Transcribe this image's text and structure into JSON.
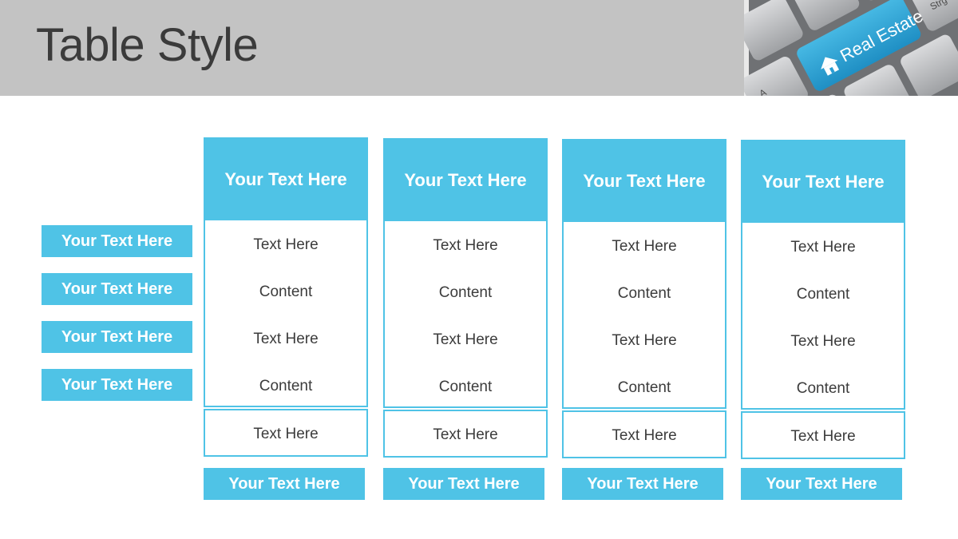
{
  "slide": {
    "title": "Table Style"
  },
  "photo": {
    "key_label": "Real Estate",
    "key_icon": "house-icon",
    "side_key_label": "Strg",
    "left_key_label": "A"
  },
  "row_labels": [
    "Your Text Here",
    "Your Text Here",
    "Your Text Here",
    "Your Text Here"
  ],
  "columns": [
    {
      "header": "Your Text Here",
      "cells": [
        "Text Here",
        "Content",
        "Text Here",
        "Content"
      ],
      "last": "Text Here",
      "footer": "Your Text Here"
    },
    {
      "header": "Your Text Here",
      "cells": [
        "Text Here",
        "Content",
        "Text Here",
        "Content"
      ],
      "last": "Text Here",
      "footer": "Your Text Here"
    },
    {
      "header": "Your Text Here",
      "cells": [
        "Text Here",
        "Content",
        "Text Here",
        "Content"
      ],
      "last": "Text Here",
      "footer": "Your Text Here"
    },
    {
      "header": "Your Text Here",
      "cells": [
        "Text Here",
        "Content",
        "Text Here",
        "Content"
      ],
      "last": "Text Here",
      "footer": "Your Text Here"
    }
  ],
  "colors": {
    "accent": "#4fc3e6",
    "header_band": "#c3c3c3",
    "title_text": "#3b3b3b",
    "body_text": "#3c3c3c"
  }
}
